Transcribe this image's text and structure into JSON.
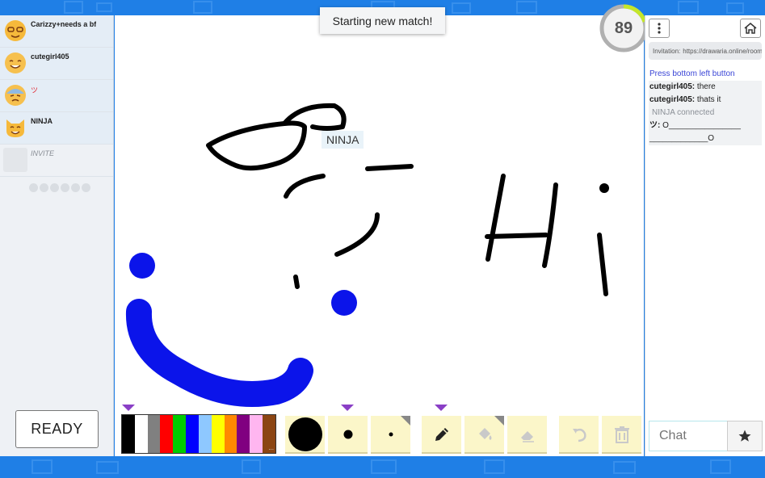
{
  "app": {
    "toast": "Starting new match!",
    "timer": "89",
    "hover_name_tag": "NINJA"
  },
  "players": [
    {
      "name": "Carizzy+needs a bf",
      "avatar": "nerd-emoji-icon"
    },
    {
      "name": "cutegirl405",
      "avatar": "smiling-emoji-icon"
    },
    {
      "name": "ツ",
      "avatar": "sweat-emoji-icon"
    },
    {
      "name": "NINJA",
      "avatar": "cat-emoji-icon"
    },
    {
      "name": "INVITE",
      "avatar": "empty-slot"
    }
  ],
  "ready_label": "READY",
  "palette": {
    "colors": [
      "#000000",
      "#ffffff",
      "#808080",
      "#ff0000",
      "#00cc00",
      "#0000ff",
      "#8ec8ff",
      "#ffff00",
      "#ff8800",
      "#800080",
      "#ffb6f0",
      "#8b4513"
    ],
    "more_label": "..."
  },
  "tools": [
    "brush-size-large",
    "brush-size-medium",
    "brush-size-small",
    "pencil-icon",
    "fill-bucket-icon",
    "eraser-icon",
    "undo-icon",
    "trash-icon"
  ],
  "right": {
    "invitation_label": "Invitation:",
    "invitation_link": "https://drawaria.online/room",
    "chat": [
      {
        "type": "system",
        "text": "Press bottom left button"
      },
      {
        "type": "message",
        "author": "cutegirl405:",
        "text": "there"
      },
      {
        "type": "message",
        "author": "cutegirl405:",
        "text": "thats it"
      },
      {
        "type": "connected",
        "text": "NINJA connected"
      },
      {
        "type": "message",
        "author": "ツ:",
        "text": "O________________"
      },
      {
        "type": "plain",
        "text": "_____________O"
      }
    ],
    "chat_placeholder": "Chat"
  }
}
